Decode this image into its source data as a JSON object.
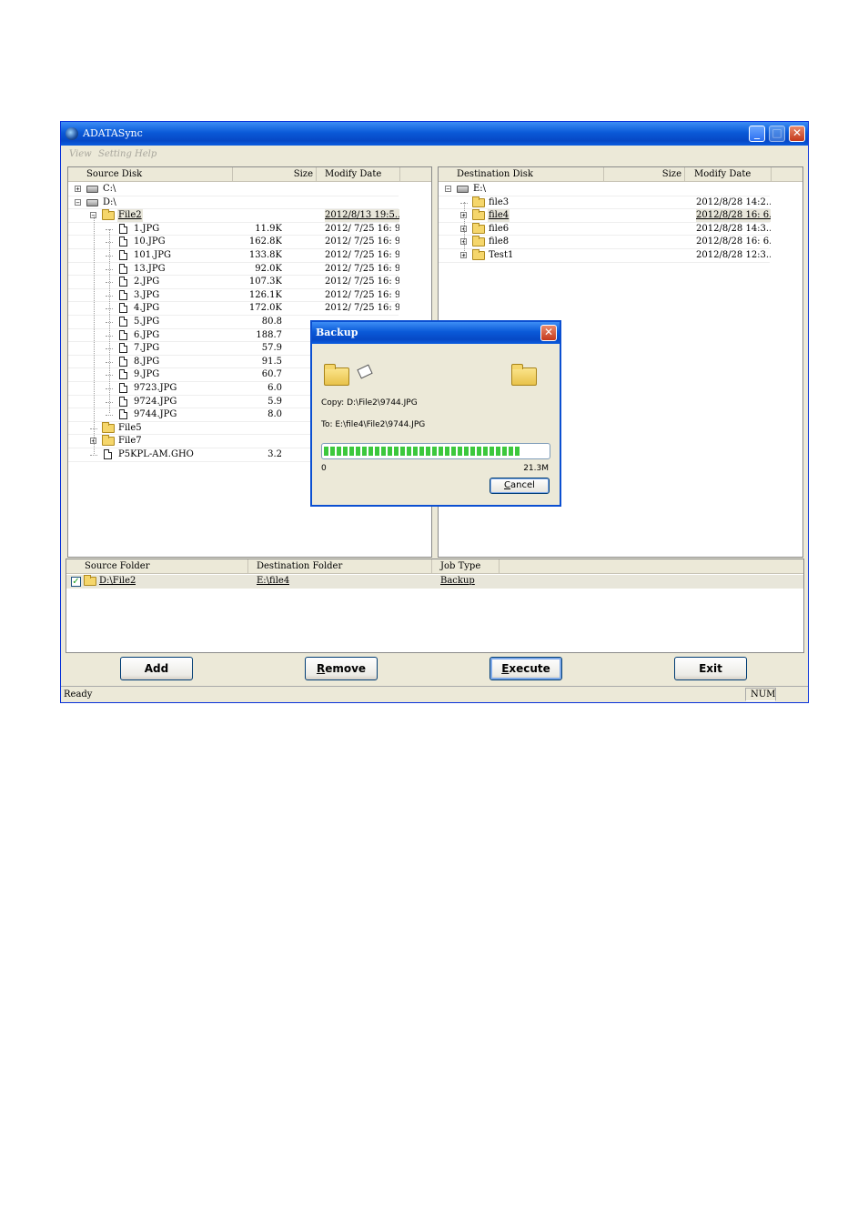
{
  "window": {
    "title": "ADATASync"
  },
  "menu": [
    "View",
    "Setting",
    "Help"
  ],
  "source": {
    "headers": {
      "name": "Source Disk",
      "size": "Size",
      "date": "Modify Date"
    },
    "rows": [
      {
        "name": "C:\\",
        "size": "",
        "date": ""
      },
      {
        "name": "D:\\",
        "size": "",
        "date": ""
      },
      {
        "name": "File2",
        "size": "",
        "date": "2012/8/13 19:5..."
      },
      {
        "name": "1.JPG",
        "size": "11.9K",
        "date": "2012/ 7/25 16: 9..."
      },
      {
        "name": "10.JPG",
        "size": "162.8K",
        "date": "2012/ 7/25 16: 9..."
      },
      {
        "name": "101.JPG",
        "size": "133.8K",
        "date": "2012/ 7/25 16: 9..."
      },
      {
        "name": "13.JPG",
        "size": "92.0K",
        "date": "2012/ 7/25 16: 9..."
      },
      {
        "name": "2.JPG",
        "size": "107.3K",
        "date": "2012/ 7/25 16: 9..."
      },
      {
        "name": "3.JPG",
        "size": "126.1K",
        "date": "2012/ 7/25 16: 9..."
      },
      {
        "name": "4.JPG",
        "size": "172.0K",
        "date": "2012/ 7/25 16: 9..."
      },
      {
        "name": "5.JPG",
        "size": "80.8",
        "date": ""
      },
      {
        "name": "6.JPG",
        "size": "188.7",
        "date": ""
      },
      {
        "name": "7.JPG",
        "size": "57.9",
        "date": ""
      },
      {
        "name": "8.JPG",
        "size": "91.5",
        "date": ""
      },
      {
        "name": "9.JPG",
        "size": "60.7",
        "date": ""
      },
      {
        "name": "9723.JPG",
        "size": "6.0",
        "date": ""
      },
      {
        "name": "9724.JPG",
        "size": "5.9",
        "date": ""
      },
      {
        "name": "9744.JPG",
        "size": "8.0",
        "date": ""
      },
      {
        "name": "File5",
        "size": "",
        "date": ""
      },
      {
        "name": "File7",
        "size": "",
        "date": ""
      },
      {
        "name": "P5KPL-AM.GHO",
        "size": "3.2",
        "date": ""
      }
    ]
  },
  "dest": {
    "headers": {
      "name": "Destination Disk",
      "size": "Size",
      "date": "Modify Date"
    },
    "rows": [
      {
        "name": "E:\\",
        "size": "",
        "date": ""
      },
      {
        "name": "file3",
        "size": "",
        "date": "2012/8/28 14:2..."
      },
      {
        "name": "file4",
        "size": "",
        "date": "2012/8/28 16: 6..."
      },
      {
        "name": "file6",
        "size": "",
        "date": "2012/8/28 14:3..."
      },
      {
        "name": "file8",
        "size": "",
        "date": "2012/8/28 16: 6..."
      },
      {
        "name": "Test1",
        "size": "",
        "date": "2012/8/28 12:3..."
      }
    ]
  },
  "jobs": {
    "headers": {
      "src": "Source Folder",
      "dst": "Destination Folder",
      "type": "Job Type"
    },
    "rows": [
      {
        "src": "D:\\File2",
        "dst": "E:\\file4",
        "type": "Backup"
      }
    ]
  },
  "buttons": {
    "add": "Add",
    "remove": "Remove",
    "execute": "Execute",
    "exit": "Exit"
  },
  "status": {
    "left": "Ready",
    "right": "NUM"
  },
  "dialog": {
    "title": "Backup",
    "copy": "Copy: D:\\File2\\9744.JPG",
    "to": "To: E:\\file4\\File2\\9744.JPG",
    "progress": 0.88,
    "min_label": "0",
    "max_label": "21.3M",
    "cancel": "Cancel"
  }
}
